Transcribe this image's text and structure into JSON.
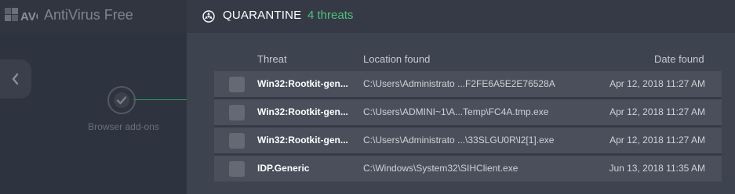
{
  "app": {
    "brand_logo": "AVG",
    "brand_name": "AntiVirus Free",
    "browser_addons_label": "Browser add-ons"
  },
  "quarantine": {
    "title": "QUARANTINE",
    "count_label": "4 threats",
    "columns": {
      "threat": "Threat",
      "location": "Location found",
      "date": "Date found"
    },
    "rows": [
      {
        "threat": "Win32:Rootkit-gen...",
        "location": "C:\\Users\\Administrato ...F2FE6A5E2E76528A",
        "date": "Apr 12, 2018 11:27 AM"
      },
      {
        "threat": "Win32:Rootkit-gen...",
        "location": "C:\\Users\\ADMINI~1\\A...Temp\\FC4A.tmp.exe",
        "date": "Apr 12, 2018 11:27 AM"
      },
      {
        "threat": "Win32:Rootkit-gen...",
        "location": "C:\\Users\\Administrato ...\\33SLGU0R\\l2[1].exe",
        "date": "Apr 12, 2018 11:27 AM"
      },
      {
        "threat": "IDP.Generic",
        "location": "C:\\Windows\\System32\\SIHClient.exe",
        "date": "Jun 13, 2018 11:35 AM"
      }
    ]
  },
  "colors": {
    "accent_green": "#4fc37a",
    "panel_bg": "#3e4350",
    "row_bg": "#4a4f5b"
  }
}
